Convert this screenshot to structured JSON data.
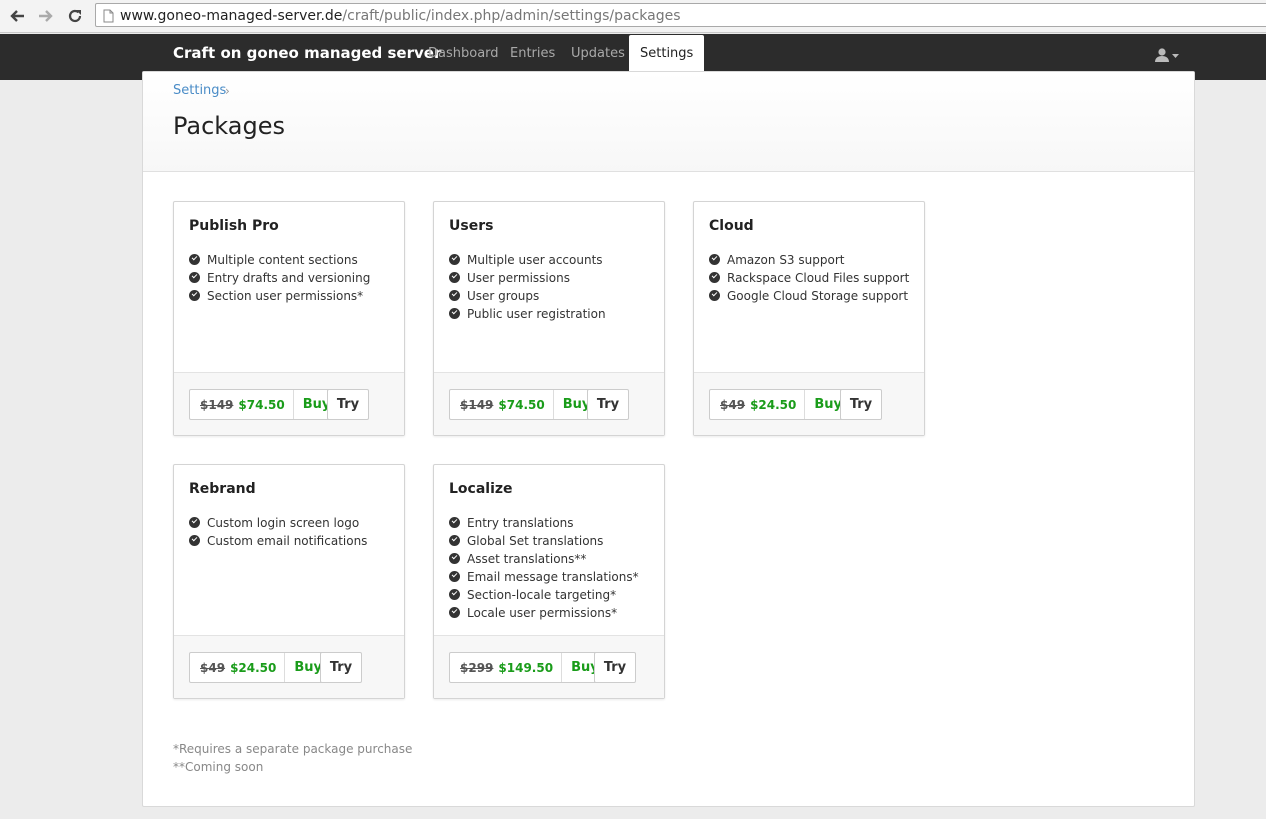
{
  "browser": {
    "url_host": "www.goneo-managed-server.de",
    "url_path": "/craft/public/index.php/admin/settings/packages"
  },
  "header": {
    "site_name": "Craft on goneo managed server",
    "tabs": [
      {
        "label": "Dashboard",
        "active": false
      },
      {
        "label": "Entries",
        "active": false
      },
      {
        "label": "Updates",
        "active": false
      },
      {
        "label": "Settings",
        "active": true
      }
    ]
  },
  "breadcrumb": {
    "label": "Settings",
    "separator": "›"
  },
  "page": {
    "title": "Packages"
  },
  "packages": [
    {
      "name": "Publish Pro",
      "features": [
        "Multiple content sections",
        "Entry drafts and versioning",
        "Section user permissions*"
      ],
      "old_price": "$149",
      "new_price": "$74.50",
      "buy": "Buy",
      "try": "Try"
    },
    {
      "name": "Users",
      "features": [
        "Multiple user accounts",
        "User permissions",
        "User groups",
        "Public user registration"
      ],
      "old_price": "$149",
      "new_price": "$74.50",
      "buy": "Buy",
      "try": "Try"
    },
    {
      "name": "Cloud",
      "features": [
        "Amazon S3 support",
        "Rackspace Cloud Files support",
        "Google Cloud Storage support"
      ],
      "old_price": "$49",
      "new_price": "$24.50",
      "buy": "Buy",
      "try": "Try"
    },
    {
      "name": "Rebrand",
      "features": [
        "Custom login screen logo",
        "Custom email notifications"
      ],
      "old_price": "$49",
      "new_price": "$24.50",
      "buy": "Buy",
      "try": "Try"
    },
    {
      "name": "Localize",
      "features": [
        "Entry translations",
        "Global Set translations",
        "Asset translations**",
        "Email message translations*",
        "Section-locale targeting*",
        "Locale user permissions*"
      ],
      "old_price": "$299",
      "new_price": "$149.50",
      "buy": "Buy",
      "try": "Try"
    }
  ],
  "footnotes": [
    "*Requires a separate package purchase",
    "**Coming soon"
  ],
  "colors": {
    "accent_green": "#1a9c1a",
    "link_blue": "#4a8cc7",
    "header_bg": "#2c2c2c"
  }
}
